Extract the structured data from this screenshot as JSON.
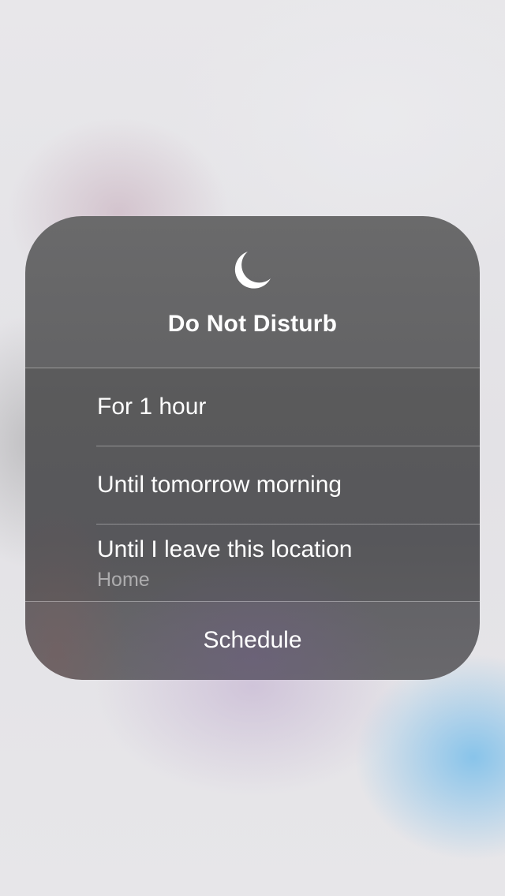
{
  "panel": {
    "icon": "moon-icon",
    "title": "Do Not Disturb",
    "options": [
      {
        "label": "For 1 hour"
      },
      {
        "label": "Until tomorrow morning"
      },
      {
        "label": "Until I leave this location",
        "sublabel": "Home"
      }
    ],
    "schedule_label": "Schedule"
  },
  "colors": {
    "panel_background": "#656566",
    "text": "#ffffff",
    "sublabel": "#a9a9ab",
    "wallpaper": "#e6e5e8",
    "wallpaper_accent_blue": "#78beeb"
  }
}
